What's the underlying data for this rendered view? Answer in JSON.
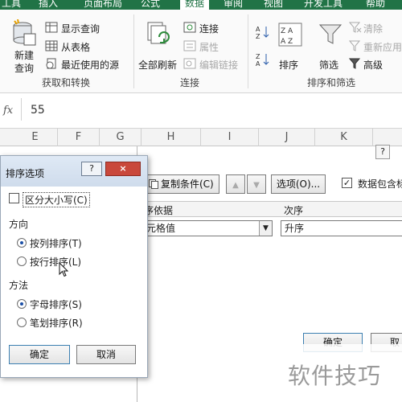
{
  "ribbon_tabs": [
    {
      "label": "工具",
      "active": false
    },
    {
      "label": "插入",
      "active": false
    },
    {
      "label": "页面布局",
      "active": false
    },
    {
      "label": "公式",
      "active": false
    },
    {
      "label": "数据",
      "active": true
    },
    {
      "label": "审阅",
      "active": false
    },
    {
      "label": "视图",
      "active": false
    },
    {
      "label": "开发工具",
      "active": false
    },
    {
      "label": "帮助",
      "active": false
    }
  ],
  "ribbon": {
    "get_transform": {
      "new_query_line1": "新建",
      "new_query_line2": "查询",
      "show_queries": "显示查询",
      "from_table": "从表格",
      "recent_sources": "最近使用的源",
      "group_label": "获取和转换"
    },
    "connections": {
      "refresh_all": "全部刷新",
      "connections": "连接",
      "properties": "属性",
      "edit_links": "编辑链接",
      "group_label": "连接"
    },
    "sort_filter": {
      "sort": "排序",
      "filter": "筛选",
      "clear": "清除",
      "reapply": "重新应用",
      "advanced": "高级",
      "group_label": "排序和筛选"
    }
  },
  "formula_bar": {
    "fx": "fx",
    "value": "55"
  },
  "columns": [
    "E",
    "F",
    "G",
    "H",
    "I",
    "J",
    "K"
  ],
  "sort_dialog": {
    "help": "?",
    "copy_level": "复制条件(C)",
    "options": "选项(O)...",
    "header_checkbox": "数据包含标",
    "col_sort_basis": "序依据",
    "col_order": "次序",
    "sort_on_value": "元格值",
    "order_value": "升序",
    "ok": "确定",
    "cancel": "取"
  },
  "sort_options_dialog": {
    "title": "排序选项",
    "help": "?",
    "close": "×",
    "case_sensitive": "区分大小写(C)",
    "orientation_label": "方向",
    "sort_top_to_bottom": "按列排序(T)",
    "sort_left_to_right": "按行排序(L)",
    "method_label": "方法",
    "method_letter": "字母排序(S)",
    "method_stroke": "笔划排序(R)",
    "ok": "确定",
    "cancel": "取消"
  },
  "watermark": "软件技巧",
  "colors": {
    "excel_green": "#217346",
    "accent_blue": "#1b4fa6"
  }
}
